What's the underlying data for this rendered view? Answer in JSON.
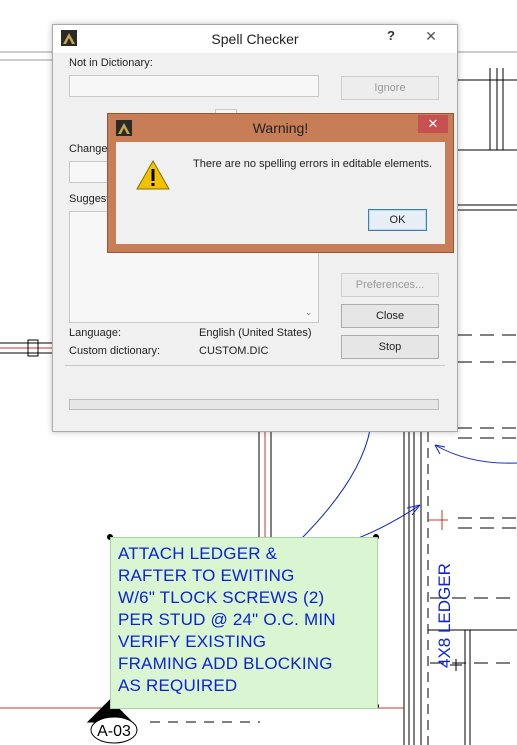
{
  "spell_checker": {
    "title": "Spell Checker",
    "help": "?",
    "close": "✕",
    "not_in_dictionary_label": "Not in Dictionary:",
    "change_label": "Change",
    "suggestions_label": "Suggest",
    "language_label": "Language:",
    "language_value": "English (United States)",
    "custom_dictionary_label": "Custom dictionary:",
    "custom_dictionary_value": "CUSTOM.DIC",
    "buttons": {
      "ignore": "Ignore",
      "preferences": "Preferences...",
      "close": "Close",
      "stop": "Stop"
    }
  },
  "warning": {
    "title": "Warning!",
    "close": "✕",
    "message": "There are no spelling errors in editable elements.",
    "ok": "OK"
  },
  "note": {
    "lines": [
      "ATTACH LEDGER &",
      "RAFTER TO EWITING",
      "W/6\" TLOCK SCREWS (2)",
      "PER STUD @ 24\" O.C. MIN",
      "VERIFY EXISTING",
      "FRAMING ADD BLOCKING",
      "AS REQUIRED"
    ],
    "text_color": "#0d23d4",
    "background_color": "#d9f5d2"
  },
  "drawing": {
    "ledger_label": "4X8 LEDGER",
    "section_tag": "A-03"
  }
}
